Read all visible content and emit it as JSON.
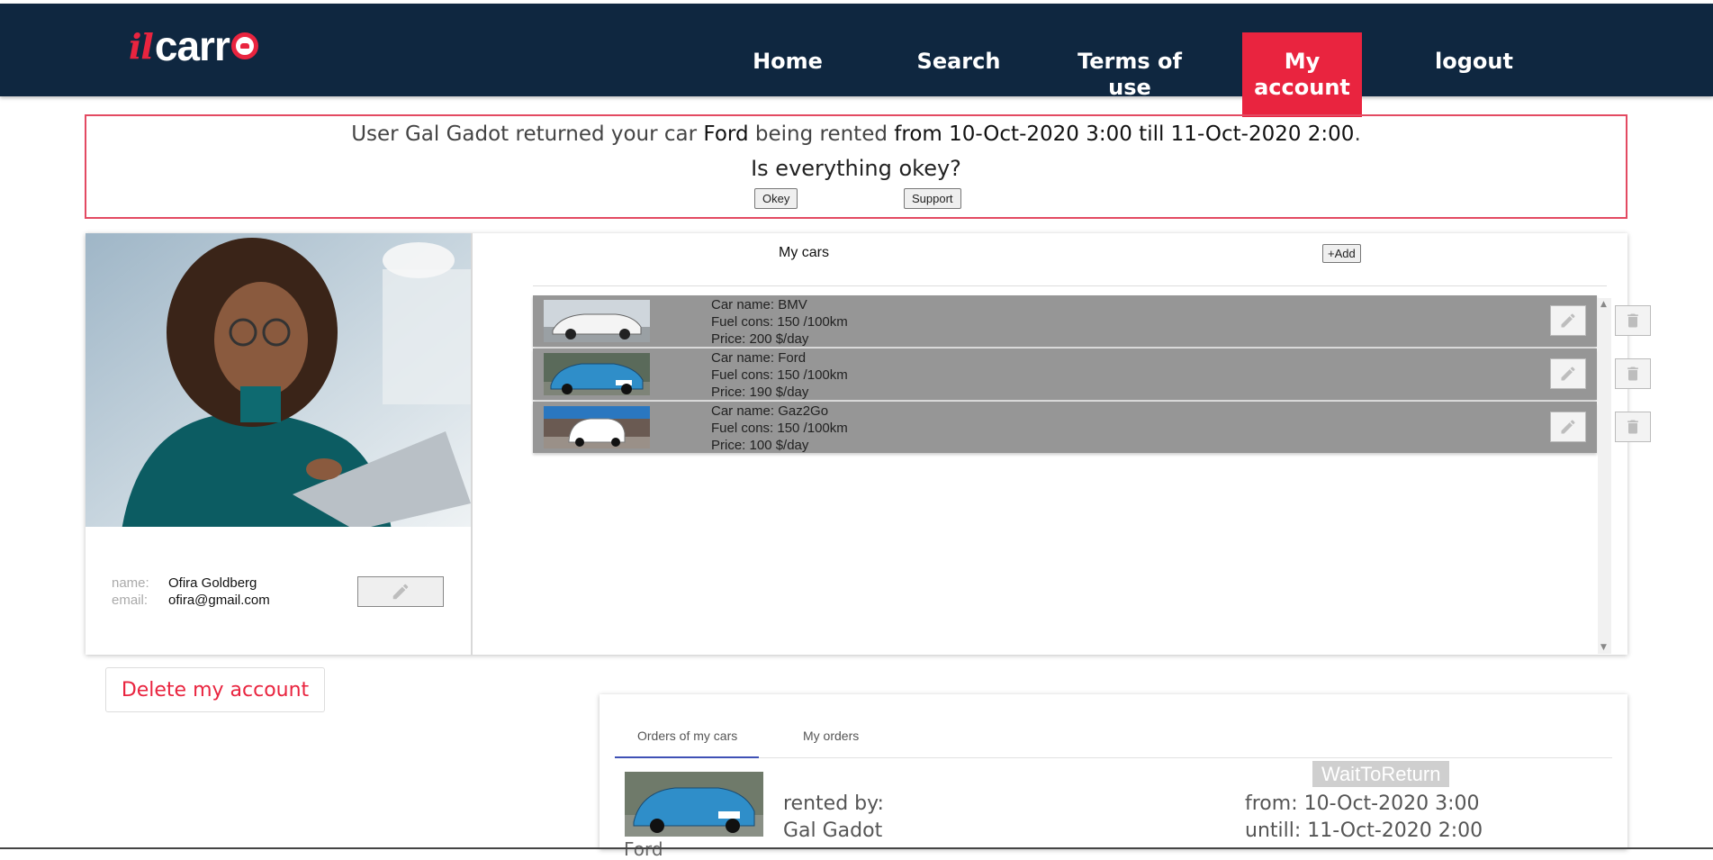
{
  "brand": {
    "logo_prefix": "il",
    "logo_main": "carr"
  },
  "nav": {
    "home": "Home",
    "search": "Search",
    "terms_line1": "Terms of",
    "terms_line2": "use",
    "account_line1": "My",
    "account_line2": "account",
    "logout": "logout"
  },
  "notice": {
    "t1": "User Gal Gadot returned your car ",
    "car": "Ford",
    "t2": " being rented ",
    "period": "from 10-Oct-2020 3:00 till 11-Oct-2020 2:00",
    "t3": ".",
    "question": "Is everything okey?",
    "okey_label": "Okey",
    "support_label": "Support"
  },
  "profile": {
    "name_label": "name:",
    "name": "Ofira Goldberg",
    "email_label": "email:",
    "email": "ofira@gmail.com"
  },
  "cars": {
    "title": "My cars",
    "add_label": "+Add",
    "items": [
      {
        "name": "Car name: BMV",
        "fuel": "Fuel cons: 150 /100km",
        "price": "Price: 200 $/day",
        "color": "#f4f4f4"
      },
      {
        "name": "Car name: Ford",
        "fuel": "Fuel cons: 150 /100km",
        "price": "Price: 190 $/day",
        "color": "#2f8ec9"
      },
      {
        "name": "Car name: Gaz2Go",
        "fuel": "Fuel cons: 150 /100km",
        "price": "Price: 100 $/day",
        "color": "#ffffff"
      }
    ]
  },
  "delete_account": "Delete my account",
  "orders": {
    "tab_orders": "Orders of my cars",
    "tab_my_orders": "My orders",
    "status": "WaitToReturn",
    "rented_by_label": "rented by:",
    "rented_by_name": "Gal Gadot",
    "from": "from: 10-Oct-2020 3:00",
    "until": "untill: 11-Oct-2020 2:00",
    "car_name": "Ford"
  },
  "colors": {
    "header_bg": "#0f2740",
    "accent": "#e9243f",
    "car_row_bg": "#969696",
    "tab_active": "#3f51b5"
  }
}
